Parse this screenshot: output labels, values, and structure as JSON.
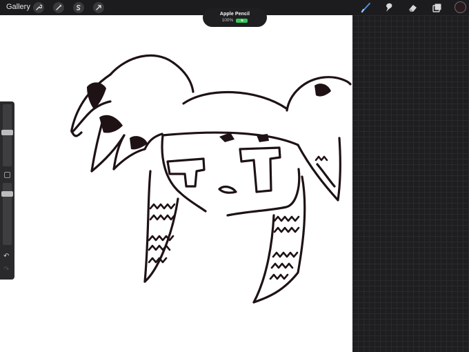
{
  "toolbar": {
    "gallery_label": "Gallery",
    "left_tools": [
      {
        "icon": "wrench-icon"
      },
      {
        "icon": "magic-wand-icon"
      },
      {
        "icon": "selection-icon"
      },
      {
        "icon": "transform-arrow-icon"
      }
    ],
    "right_tools": [
      {
        "icon": "brush-icon",
        "active": true
      },
      {
        "icon": "smudge-icon"
      },
      {
        "icon": "eraser-icon"
      },
      {
        "icon": "layers-icon"
      }
    ],
    "color_swatch": "#2a1a1e"
  },
  "pencil_toast": {
    "title": "Apple Pencil",
    "battery_percent": "100%",
    "battery_color": "#35c759"
  },
  "colors": {
    "topbar": "#1c1c1e",
    "canvas": "#ffffff",
    "panel": "#1e1e20",
    "ink": "#1e1214",
    "active_tool": "#4a90e2"
  },
  "sidebar": {
    "size_slider_level": 0.55,
    "opacity_slider_level": 0.85
  }
}
